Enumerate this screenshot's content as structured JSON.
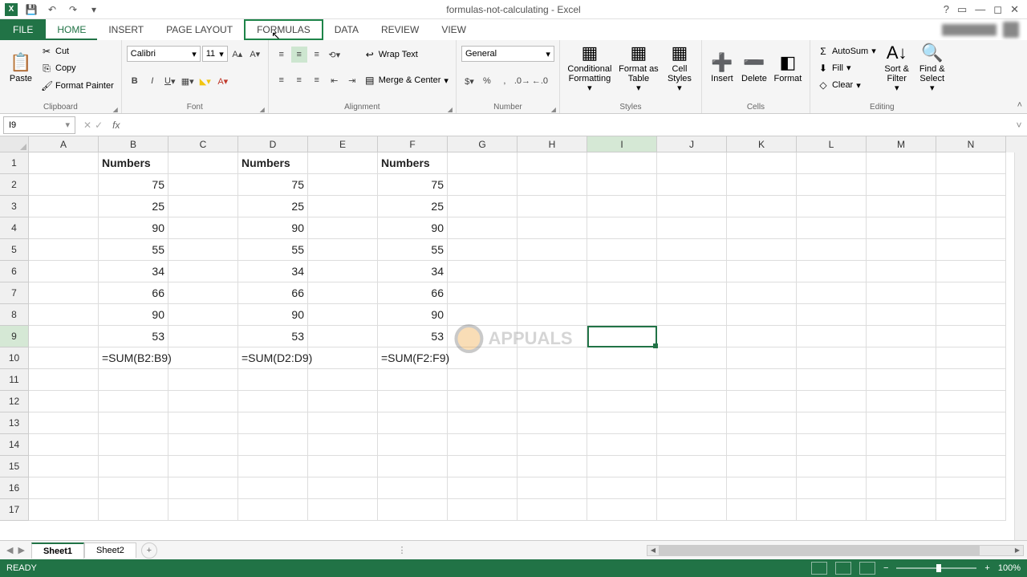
{
  "title": "formulas-not-calculating - Excel",
  "qat": {
    "save": "💾",
    "undo": "↶",
    "redo": "↷"
  },
  "tabs": {
    "file": "FILE",
    "home": "HOME",
    "insert": "INSERT",
    "page_layout": "PAGE LAYOUT",
    "formulas": "FORMULAS",
    "data": "DATA",
    "review": "REVIEW",
    "view": "VIEW"
  },
  "ribbon": {
    "clipboard": {
      "paste": "Paste",
      "cut": "Cut",
      "copy": "Copy",
      "format_painter": "Format Painter",
      "label": "Clipboard"
    },
    "font": {
      "name": "Calibri",
      "size": "11",
      "label": "Font"
    },
    "alignment": {
      "wrap": "Wrap Text",
      "merge": "Merge & Center",
      "label": "Alignment"
    },
    "number": {
      "format": "General",
      "label": "Number"
    },
    "styles": {
      "cond": "Conditional\nFormatting",
      "table": "Format as\nTable",
      "cell": "Cell\nStyles",
      "label": "Styles"
    },
    "cells": {
      "insert": "Insert",
      "delete": "Delete",
      "format": "Format",
      "label": "Cells"
    },
    "editing": {
      "autosum": "AutoSum",
      "fill": "Fill",
      "clear": "Clear",
      "sort": "Sort &\nFilter",
      "find": "Find &\nSelect",
      "label": "Editing"
    }
  },
  "name_box": "I9",
  "formula_value": "",
  "columns": [
    "A",
    "B",
    "C",
    "D",
    "E",
    "F",
    "G",
    "H",
    "I",
    "J",
    "K",
    "L",
    "M",
    "N"
  ],
  "cells": {
    "B1": "Numbers",
    "D1": "Numbers",
    "F1": "Numbers",
    "B2": "75",
    "D2": "75",
    "F2": "75",
    "B3": "25",
    "D3": "25",
    "F3": "25",
    "B4": "90",
    "D4": "90",
    "F4": "90",
    "B5": "55",
    "D5": "55",
    "F5": "55",
    "B6": "34",
    "D6": "34",
    "F6": "34",
    "B7": "66",
    "D7": "66",
    "F7": "66",
    "B8": "90",
    "D8": "90",
    "F8": "90",
    "B9": "53",
    "D9": "53",
    "F9": "53",
    "B10": "=SUM(B2:B9)",
    "D10": "=SUM(D2:D9)",
    "F10": "=SUM(F2:F9)"
  },
  "selected_cell": "I9",
  "sheets": {
    "s1": "Sheet1",
    "s2": "Sheet2"
  },
  "status": {
    "ready": "READY",
    "zoom": "100%"
  },
  "watermark": "APPUALS"
}
